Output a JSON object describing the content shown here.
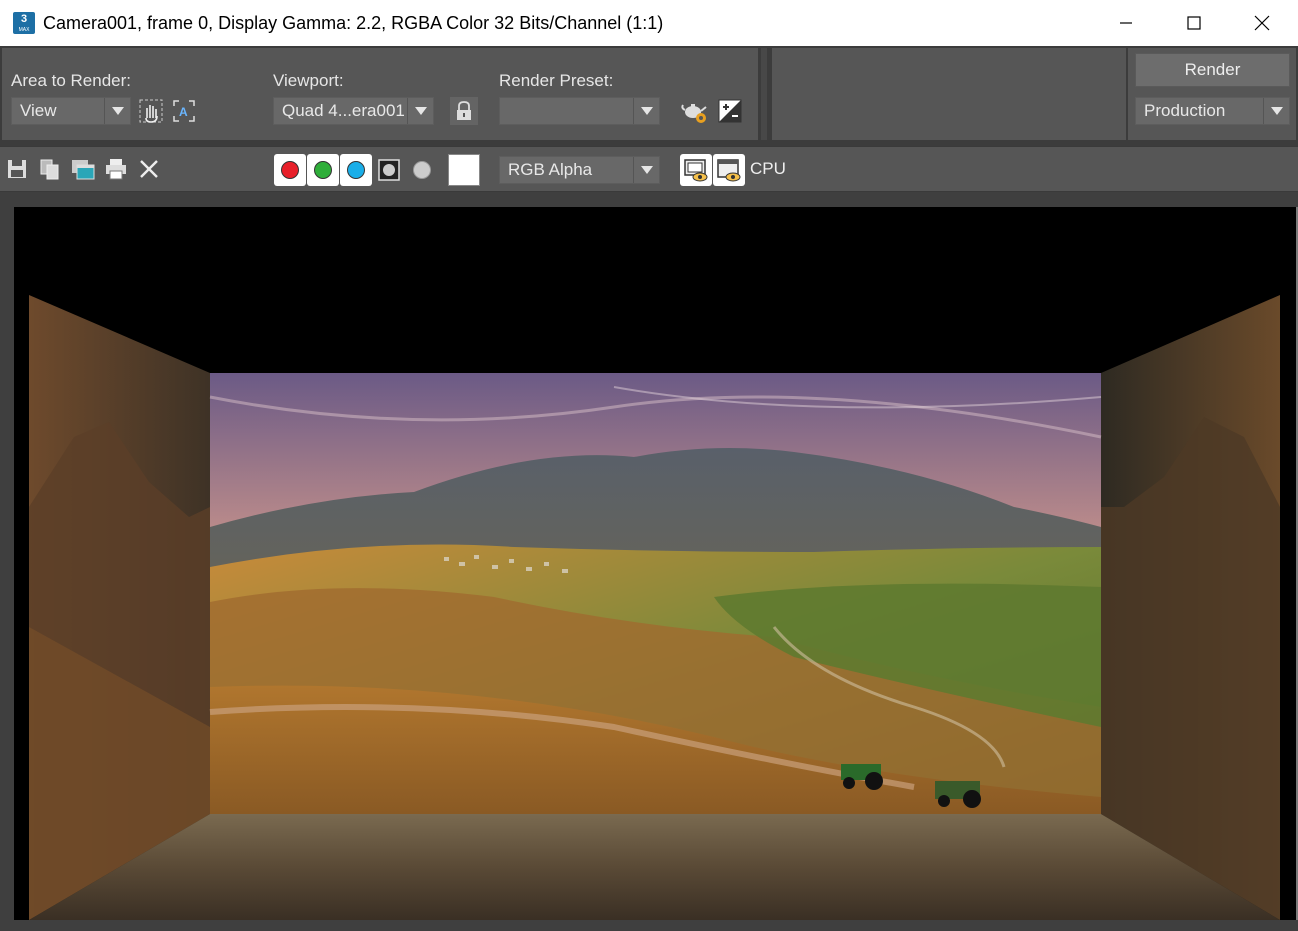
{
  "window": {
    "title": "Camera001, frame 0, Display Gamma: 2.2, RGBA Color 32 Bits/Channel (1:1)",
    "app_icon_text": "3",
    "app_icon_sub": "MAX"
  },
  "settings": {
    "area_to_render_label": "Area to Render:",
    "area_to_render_value": "View",
    "viewport_label": "Viewport:",
    "viewport_value": "Quad 4...era001 ",
    "render_preset_label": "Render Preset:",
    "render_preset_value": "",
    "render_button": "Render",
    "mode_value": "Production"
  },
  "toolbar": {
    "channel_display_value": "RGB Alpha",
    "cpu_label": "CPU"
  },
  "colors": {
    "red_channel": "#e8202a",
    "green_channel": "#2fae3a",
    "blue_channel": "#1aaee8"
  }
}
